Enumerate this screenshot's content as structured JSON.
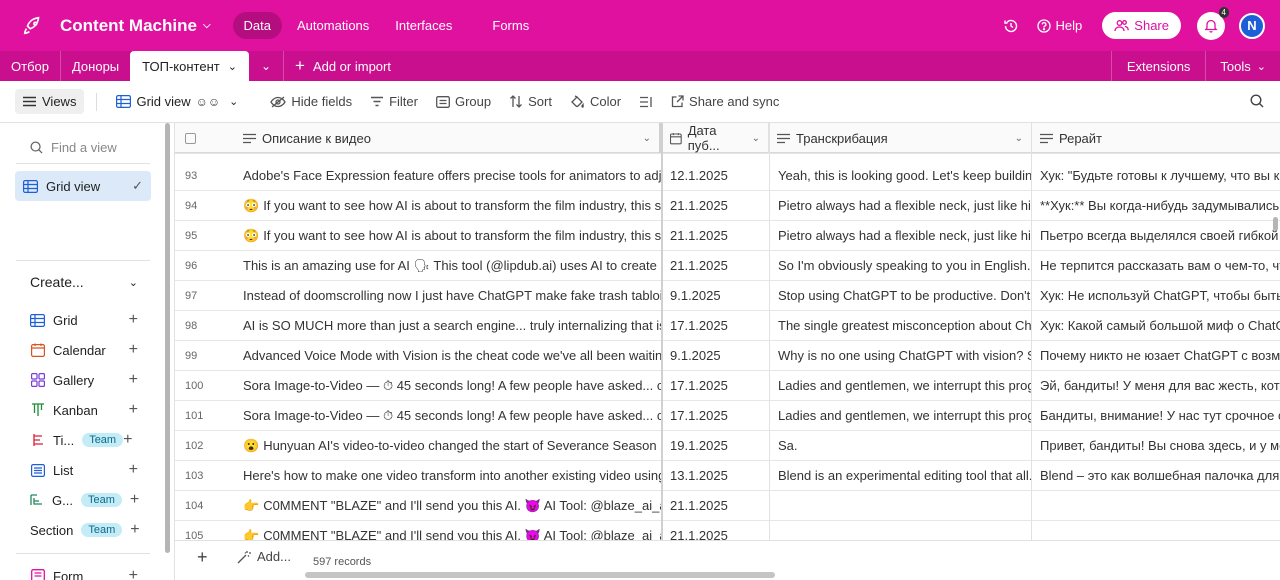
{
  "app": {
    "base_name": "Content Machine",
    "nav": [
      "Data",
      "Automations",
      "Interfaces",
      "Forms"
    ],
    "help_label": "Help",
    "share_label": "Share",
    "notification_count": "4",
    "avatar_initial": "N"
  },
  "tabs": {
    "items": [
      "Отбор",
      "Доноры"
    ],
    "active": "ТОП-контент",
    "add_label": "Add or import",
    "extensions": "Extensions",
    "tools": "Tools"
  },
  "toolbar": {
    "views": "Views",
    "grid_view": "Grid view",
    "hide_fields": "Hide fields",
    "filter": "Filter",
    "group": "Group",
    "sort": "Sort",
    "color": "Color",
    "share_sync": "Share and sync"
  },
  "sidebar": {
    "find_placeholder": "Find a view",
    "active_view": "Grid view",
    "create_label": "Create...",
    "create_items": [
      {
        "label": "Grid",
        "team": ""
      },
      {
        "label": "Calendar",
        "team": ""
      },
      {
        "label": "Gallery",
        "team": ""
      },
      {
        "label": "Kanban",
        "team": ""
      },
      {
        "label": "Ti...",
        "team": "Team"
      },
      {
        "label": "List",
        "team": ""
      },
      {
        "label": "G...",
        "team": "Team"
      }
    ],
    "section_label": "Section",
    "section_team": "Team",
    "form_label": "Form"
  },
  "grid": {
    "columns": [
      "Описание к видео",
      "Дата пуб...",
      "Транскрибация",
      "Рерайт"
    ],
    "rows": [
      {
        "n": "93",
        "desc": "Adobe's Face Expression feature offers precise tools for animators to adjust...",
        "emoji": "",
        "date": "12.1.2025",
        "trans": "Yeah, this is looking good. Let's keep buildin...",
        "rew": "Хук: \"Будьте готовы к лучшему, что вы когд"
      },
      {
        "n": "94",
        "desc": "If you want to see how AI is about to transform the film industry, this s...",
        "emoji": "😳",
        "date": "21.1.2025",
        "trans": "Pietro always had a flexible neck, just like his...",
        "rew": "**Хук:** Вы когда-нибудь задумывались, ка"
      },
      {
        "n": "95",
        "desc": "If you want to see how AI is about to transform the film industry, this s...",
        "emoji": "😳",
        "date": "21.1.2025",
        "trans": "Pietro always had a flexible neck, just like his...",
        "rew": "Пьетро всегда выделялся своей гибкой шее"
      },
      {
        "n": "96",
        "desc": "This is an amazing use for AI 🗣 This tool (@lipdub.ai) uses AI to create sm...",
        "emoji": "",
        "date": "21.1.2025",
        "trans": "So I'm obviously speaking to you in English. I...",
        "rew": "Не терпится рассказать вам о чем-то, что п"
      },
      {
        "n": "97",
        "desc": "Instead of doomscrolling now I just have ChatGPT make fake trash tabloids...",
        "emoji": "",
        "date": "9.1.2025",
        "trans": "Stop using ChatGPT to be productive. Don't ...",
        "rew": "Хук: Не используй ChatGPT, чтобы быть про"
      },
      {
        "n": "98",
        "desc": "AI is SO MUCH more than just a search engine... truly internalizing that is w...",
        "emoji": "",
        "date": "17.1.2025",
        "trans": "The single greatest misconception about Ch...",
        "rew": "Хук: Какой самый большой миф о ChatGPT?"
      },
      {
        "n": "99",
        "desc": "Advanced Voice Mode with Vision is the cheat code we've all been waiting ...",
        "emoji": "",
        "date": "9.1.2025",
        "trans": "Why is no one using ChatGPT with vision? St...",
        "rew": "Почему никто не юзает ChatGPT с возможн"
      },
      {
        "n": "100",
        "desc": "Sora Image-to-Video — ⏱ 45 seconds long! A few people have asked... ca...",
        "emoji": "",
        "date": "17.1.2025",
        "trans": "Ladies and gentlemen, we interrupt this prog...",
        "rew": "Эй, бандиты! У меня для вас жесть, которая"
      },
      {
        "n": "101",
        "desc": "Sora Image-to-Video — ⏱ 45 seconds long! A few people have asked... ca...",
        "emoji": "",
        "date": "17.1.2025",
        "trans": "Ladies and gentlemen, we interrupt this prog...",
        "rew": "Бандиты, внимание! У нас тут срочное сооб"
      },
      {
        "n": "102",
        "desc": "Hunyuan AI's video-to-video changed the start of Severance Season 2, ...",
        "emoji": "😮",
        "date": "19.1.2025",
        "trans": "Sa.",
        "rew": "Привет, бандиты! Вы снова здесь, и у меня"
      },
      {
        "n": "103",
        "desc": "Here's how to make one video transform into another existing video using ...",
        "emoji": "",
        "date": "13.1.2025",
        "trans": "Blend is an experimental editing tool that all...",
        "rew": "Blend – это как волшебная палочка для ваш"
      },
      {
        "n": "104",
        "desc": "C0MMENT \"BLAZE\" and I'll send you this AI. 😈 AI Tool: @blaze_ai_app...",
        "emoji": "👉",
        "date": "21.1.2025",
        "trans": "",
        "rew": ""
      },
      {
        "n": "105",
        "desc": "C0MMENT \"BLAZE\" and I'll send you this AI. 😈 AI Tool: @blaze_ai_app...",
        "emoji": "👉",
        "date": "21.1.2025",
        "trans": "",
        "rew": ""
      }
    ],
    "add_label": "Add...",
    "records": "597 records"
  },
  "colors": {
    "brand": "#e0119f",
    "tabbar": "#c90f8e",
    "selected_view": "#dce9f9"
  }
}
